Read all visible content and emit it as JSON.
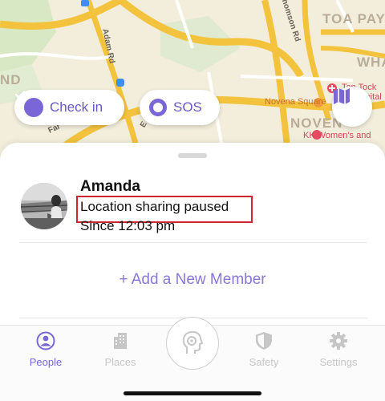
{
  "map": {
    "labels": {
      "toa_payoh": "TOA PAYO",
      "wha": "WHA",
      "novena_area": "NOVEN",
      "nd": "ND",
      "e": "E",
      "adam_rd": "Adam Rd",
      "thomson_rd": "homson Rd",
      "farrer": "Far",
      "novena_square": "Novena Square",
      "tan_tock_seng_1": "Tan Tock",
      "tan_tock_seng_2": "Hospital",
      "kk_hospital": "KK Women's and"
    },
    "buttons": {
      "check_in": "Check in",
      "sos": "SOS"
    },
    "icons": {
      "check_in": "check-circle-icon",
      "sos": "ring-icon",
      "map": "map-icon"
    }
  },
  "member": {
    "name": "Amanda",
    "status": "Location sharing paused",
    "since": "Since 12:03 pm"
  },
  "actions": {
    "add_member": "+ Add a New Member"
  },
  "tabs": [
    {
      "label": "People",
      "icon": "person-icon",
      "active": true
    },
    {
      "label": "Places",
      "icon": "building-icon",
      "active": false
    },
    {
      "label": "Safety",
      "icon": "shield-icon",
      "active": false
    },
    {
      "label": "Settings",
      "icon": "gear-icon",
      "active": false
    }
  ],
  "colors": {
    "accent": "#7a66d6",
    "highlight_box": "#d0262d",
    "inactive_tab": "#c6c6c6"
  }
}
